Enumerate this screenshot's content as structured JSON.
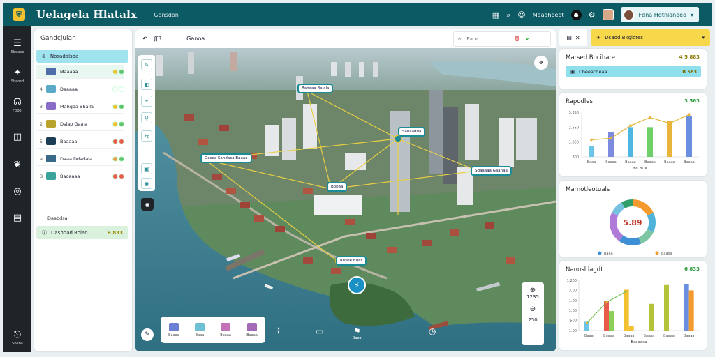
{
  "header": {
    "logo_glyph": "⛨",
    "app_title": "Uelagela Hlatalx",
    "subtitle": "Gonsdon",
    "right_label": "Maaahdedt",
    "user_name": "Fdna Hdtnlaneeo"
  },
  "rail": {
    "items": [
      {
        "icon": "☰",
        "label": "Sboaoe"
      },
      {
        "icon": "✦",
        "label": "Sbeosd"
      },
      {
        "icon": "☊",
        "label": "Fpbol"
      },
      {
        "icon": "◫",
        "label": ""
      },
      {
        "icon": "❦",
        "label": ""
      },
      {
        "icon": "◎",
        "label": ""
      },
      {
        "icon": "▤",
        "label": ""
      },
      {
        "icon": "⎋",
        "label": "Sbeba"
      }
    ]
  },
  "left_panel": {
    "title": "Gandcjuian",
    "header_label": "Nosadalsda",
    "rows": [
      {
        "num": "",
        "label": "Maaaaa",
        "icon_color": "#4d6ea8",
        "dots": [
          "#f2c130",
          "#5fc46e"
        ]
      },
      {
        "num": "4",
        "label": "Daaaaa",
        "icon_color": "#5aa9c9",
        "dots": [
          "#ffffff",
          "#ffffff"
        ]
      },
      {
        "num": "3",
        "label": "Mahgoa Bhalla",
        "icon_color": "#8a6cc9",
        "dots": [
          "#f2c130",
          "#5fc46e"
        ]
      },
      {
        "num": "2",
        "label": "Dslap Gaala",
        "icon_color": "#b9a32c",
        "dots": [
          "#f2c130",
          "#5fc46e"
        ]
      },
      {
        "num": "5",
        "label": "Baaaaa",
        "icon_color": "#1d3f55",
        "dots": [
          "#e85b4a",
          "#e85b4a"
        ]
      },
      {
        "num": "a",
        "label": "Daaa Ddadala",
        "icon_color": "#3a6a8a",
        "dots": [
          "#e8a04a",
          "#5fc46e"
        ]
      },
      {
        "num": "B",
        "label": "Baoaaaa",
        "icon_color": "#3aa39a",
        "dots": [
          "#e85b4a",
          "#e85b4a"
        ]
      }
    ],
    "footer_caption": "Daabdsa",
    "footer_label": "Dashdad Rolao",
    "footer_value": "B 833"
  },
  "map": {
    "toolbar_label": "Ganoa",
    "toolbar_glyph": "ʃʃ3",
    "search_placeholder": "Eaoa",
    "pins": [
      {
        "label": "Bahaaa Balala",
        "dark": false
      },
      {
        "label": "Saoaadda",
        "dark": false
      },
      {
        "label": "Desea Sahdaca Baaao",
        "dark": false
      },
      {
        "label": "Sdaaaaa Gaanaa",
        "dark": false
      },
      {
        "label": "Bopaa",
        "dark": false
      },
      {
        "label": "Rnsbe Bdas",
        "dark": false
      }
    ],
    "zoom_label_1": "1235",
    "zoom_label_2": "250",
    "bottom_tools": [
      {
        "label": "Baaaa",
        "color": "#6b7fd4"
      },
      {
        "label": "Baaa",
        "color": "#6ec0d4"
      },
      {
        "label": "Bpaaa",
        "color": "#c473b9"
      },
      {
        "label": "Baaaa",
        "color": "#a46ab8"
      }
    ],
    "float_icon_label": "Baaa"
  },
  "right_panel": {
    "top_left_glyph": "▤",
    "top_label": "Dsadd Bkglotes",
    "card1": {
      "title": "Marsed Bocihate",
      "value": "4 5 883",
      "bar_label": "Cbeeacdeaa",
      "bar_value": "B 583"
    },
    "card2": {
      "title": "Rapodles",
      "value": "3 563"
    },
    "card3": {
      "title": "Marnotleotuals",
      "center_value": "5.89"
    },
    "card4": {
      "title": "Nanusl lagdt",
      "value": "6 833"
    }
  },
  "chart_data": [
    {
      "type": "bar",
      "categories": [
        "Baaa",
        "Saaaa",
        "Baaaa",
        "Baaaa",
        "Baaaa",
        "Baaaa"
      ],
      "values": [
        1.5,
        3.3,
        4.0,
        4.0,
        4.8,
        5.5
      ],
      "series": [
        {
          "values": [
            1.5,
            3.3,
            4.0,
            4.0,
            4.8,
            5.5
          ]
        },
        {
          "values": [
            2.3,
            2.5,
            4.2,
            5.3,
            4.5,
            5.7
          ]
        }
      ],
      "yticks": [
        "3.350",
        "2.550",
        "1.050",
        "300"
      ],
      "xlabel": "Bs BDa",
      "colors": [
        "#6cc4e6",
        "#7c8ae0",
        "#4fb7e2",
        "#6fd06a",
        "#e8b53a",
        "#6a8fe0"
      ]
    },
    {
      "type": "pie",
      "values": [
        18,
        14,
        12,
        16,
        22,
        10,
        8
      ],
      "colors": [
        "#f39a2e",
        "#4fb3d9",
        "#7cc6a3",
        "#3f8fd6",
        "#b07ad8",
        "#76c2e0",
        "#2f9e68"
      ],
      "legend": [
        "Baea",
        "Baaoa"
      ]
    },
    {
      "type": "bar",
      "categories": [
        "Baaa",
        "Baaaa",
        "Baaaa",
        "Baaaa",
        "Baaaa",
        "Baaaa"
      ],
      "series": [
        {
          "values": [
            2.8,
            9.5,
            13.0,
            0,
            14.5,
            14.8
          ]
        },
        {
          "values": [
            0,
            6.2,
            1.5,
            8.5,
            0,
            12.8
          ]
        }
      ],
      "yticks": [
        "1.200",
        "3.00",
        "1.00",
        "1.00",
        "500",
        "1.00"
      ],
      "xlabel": "Bsaaasa",
      "colors": [
        "#6cc4e6",
        "#e85b4a",
        "#f2c130",
        "#3fb0d6",
        "#b5c33b",
        "#6a8fe0"
      ]
    }
  ]
}
